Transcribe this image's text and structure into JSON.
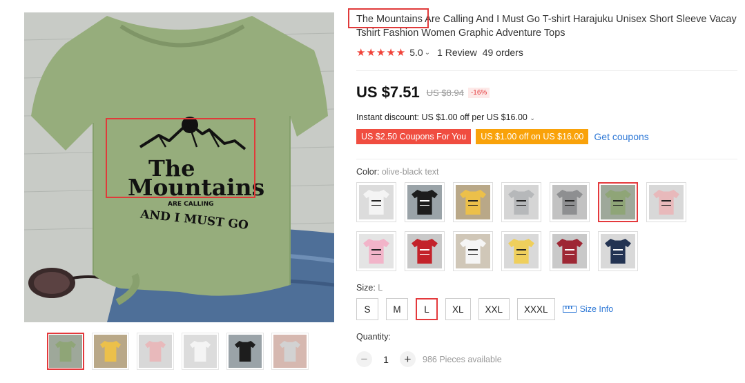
{
  "product": {
    "title_line1": "The Mountains Are Calling And I Must Go T-shirt Harajuku Unisex Short Sleeve Vacay",
    "title_line2": "Tshirt Fashion Women Graphic Adventure Tops",
    "title_highlight": "The Mountains",
    "stars": "★★★★★",
    "rating": "5.0",
    "reviews": "1 Review",
    "orders": "49 orders"
  },
  "shirt_print": {
    "line1": "The",
    "line2": "Mountains",
    "line3": "ARE CALLING",
    "line4": "AND I MUST GO"
  },
  "price": {
    "current": "US $7.51",
    "original": "US $8.94",
    "discount": "-16%"
  },
  "instant_discount": "Instant discount: US $1.00 off per US $16.00",
  "coupons": {
    "coupon1": "US $2.50 Coupons For You",
    "coupon2": "US $1.00 off on US $16.00",
    "get": "Get coupons"
  },
  "color": {
    "label": "Color:",
    "selected": "olive-black text",
    "swatches": [
      {
        "name": "white",
        "bg": "#dcdcdc",
        "shirt": "#f4f4f4",
        "ink": "#222222"
      },
      {
        "name": "black",
        "bg": "#9aa3a8",
        "shirt": "#1d1d1d",
        "ink": "#ffffff"
      },
      {
        "name": "yellow",
        "bg": "#b9a888",
        "shirt": "#ecc04a",
        "ink": "#222222"
      },
      {
        "name": "grey",
        "bg": "#d5d5d5",
        "shirt": "#b6b8ba",
        "ink": "#222222"
      },
      {
        "name": "dark-grey",
        "bg": "#c2c2c2",
        "shirt": "#8e8f91",
        "ink": "#222222"
      },
      {
        "name": "olive",
        "bg": "#9ea89a",
        "shirt": "#8fa577",
        "ink": "#222222"
      },
      {
        "name": "pink",
        "bg": "#d8d8d8",
        "shirt": "#e8b9bb",
        "ink": "#222222"
      },
      {
        "name": "light-pink",
        "bg": "#e4e4e4",
        "shirt": "#f2b4c9",
        "ink": "#222222"
      },
      {
        "name": "red",
        "bg": "#c9c9c9",
        "shirt": "#c3222a",
        "ink": "#ffffff"
      },
      {
        "name": "white-2",
        "bg": "#d0c7b8",
        "shirt": "#f5f5f5",
        "ink": "#222222"
      },
      {
        "name": "yellow-2",
        "bg": "#d9d9d9",
        "shirt": "#efcf5c",
        "ink": "#222222"
      },
      {
        "name": "burgundy",
        "bg": "#c9c9c9",
        "shirt": "#9e2734",
        "ink": "#ffffff"
      },
      {
        "name": "navy",
        "bg": "#d9d9d9",
        "shirt": "#233352",
        "ink": "#ffffff"
      }
    ]
  },
  "size": {
    "label": "Size:",
    "selected": "L",
    "options": [
      "S",
      "M",
      "L",
      "XL",
      "XXL",
      "XXXL"
    ],
    "info": "Size Info"
  },
  "quantity": {
    "label": "Quantity:",
    "value": "1",
    "minus": "−",
    "plus": "+",
    "available": "986 Pieces available"
  },
  "thumbnails": [
    {
      "bg": "#9ea89a",
      "shirt": "#8fa577"
    },
    {
      "bg": "#b9a888",
      "shirt": "#ecc04a"
    },
    {
      "bg": "#d8d8d8",
      "shirt": "#e8b9bb"
    },
    {
      "bg": "#dcdcdc",
      "shirt": "#f4f4f4"
    },
    {
      "bg": "#9aa3a8",
      "shirt": "#1d1d1d"
    },
    {
      "bg": "#d6b8b0",
      "shirt": "#d2d2d2"
    }
  ],
  "colors": {
    "accent_red": "#e4393c",
    "link_blue": "#2e78d6",
    "coupon_red": "#f04d40",
    "coupon_orange": "#f9a20a",
    "star_red": "#f0433a"
  }
}
